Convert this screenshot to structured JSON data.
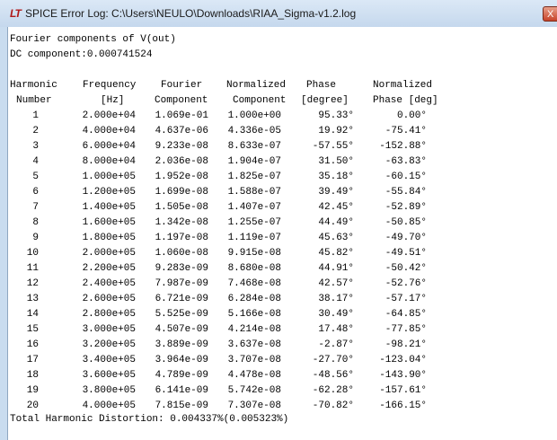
{
  "window": {
    "title": "SPICE Error Log: C:\\Users\\NEULO\\Downloads\\RIAA_Sigma-v1.2.log",
    "logo": "LT",
    "close": "X"
  },
  "log": {
    "heading": "Fourier components of V(out)",
    "dc": "DC component:0.000741524",
    "headers": {
      "h1a": "Harmonic",
      "h1b": "Number",
      "h2a": "Frequency",
      "h2b": "[Hz]",
      "h3a": "Fourier",
      "h3b": "Component",
      "h4a": "Normalized",
      "h4b": "Component",
      "h5a": "Phase",
      "h5b": "[degree]",
      "h6a": "Normalized",
      "h6b": "Phase [deg]"
    },
    "rows": [
      [
        "1",
        "2.000e+04",
        "1.069e-01",
        "1.000e+00",
        "95.33°",
        "0.00°"
      ],
      [
        "2",
        "4.000e+04",
        "4.637e-06",
        "4.336e-05",
        "19.92°",
        "-75.41°"
      ],
      [
        "3",
        "6.000e+04",
        "9.233e-08",
        "8.633e-07",
        "-57.55°",
        "-152.88°"
      ],
      [
        "4",
        "8.000e+04",
        "2.036e-08",
        "1.904e-07",
        "31.50°",
        "-63.83°"
      ],
      [
        "5",
        "1.000e+05",
        "1.952e-08",
        "1.825e-07",
        "35.18°",
        "-60.15°"
      ],
      [
        "6",
        "1.200e+05",
        "1.699e-08",
        "1.588e-07",
        "39.49°",
        "-55.84°"
      ],
      [
        "7",
        "1.400e+05",
        "1.505e-08",
        "1.407e-07",
        "42.45°",
        "-52.89°"
      ],
      [
        "8",
        "1.600e+05",
        "1.342e-08",
        "1.255e-07",
        "44.49°",
        "-50.85°"
      ],
      [
        "9",
        "1.800e+05",
        "1.197e-08",
        "1.119e-07",
        "45.63°",
        "-49.70°"
      ],
      [
        "10",
        "2.000e+05",
        "1.060e-08",
        "9.915e-08",
        "45.82°",
        "-49.51°"
      ],
      [
        "11",
        "2.200e+05",
        "9.283e-09",
        "8.680e-08",
        "44.91°",
        "-50.42°"
      ],
      [
        "12",
        "2.400e+05",
        "7.987e-09",
        "7.468e-08",
        "42.57°",
        "-52.76°"
      ],
      [
        "13",
        "2.600e+05",
        "6.721e-09",
        "6.284e-08",
        "38.17°",
        "-57.17°"
      ],
      [
        "14",
        "2.800e+05",
        "5.525e-09",
        "5.166e-08",
        "30.49°",
        "-64.85°"
      ],
      [
        "15",
        "3.000e+05",
        "4.507e-09",
        "4.214e-08",
        "17.48°",
        "-77.85°"
      ],
      [
        "16",
        "3.200e+05",
        "3.889e-09",
        "3.637e-08",
        "-2.87°",
        "-98.21°"
      ],
      [
        "17",
        "3.400e+05",
        "3.964e-09",
        "3.707e-08",
        "-27.70°",
        "-123.04°"
      ],
      [
        "18",
        "3.600e+05",
        "4.789e-09",
        "4.478e-08",
        "-48.56°",
        "-143.90°"
      ],
      [
        "19",
        "3.800e+05",
        "6.141e-09",
        "5.742e-08",
        "-62.28°",
        "-157.61°"
      ],
      [
        "20",
        "4.000e+05",
        "7.815e-09",
        "7.307e-08",
        "-70.82°",
        "-166.15°"
      ]
    ],
    "thd": "Total Harmonic Distortion: 0.004337%(0.005323%)"
  }
}
